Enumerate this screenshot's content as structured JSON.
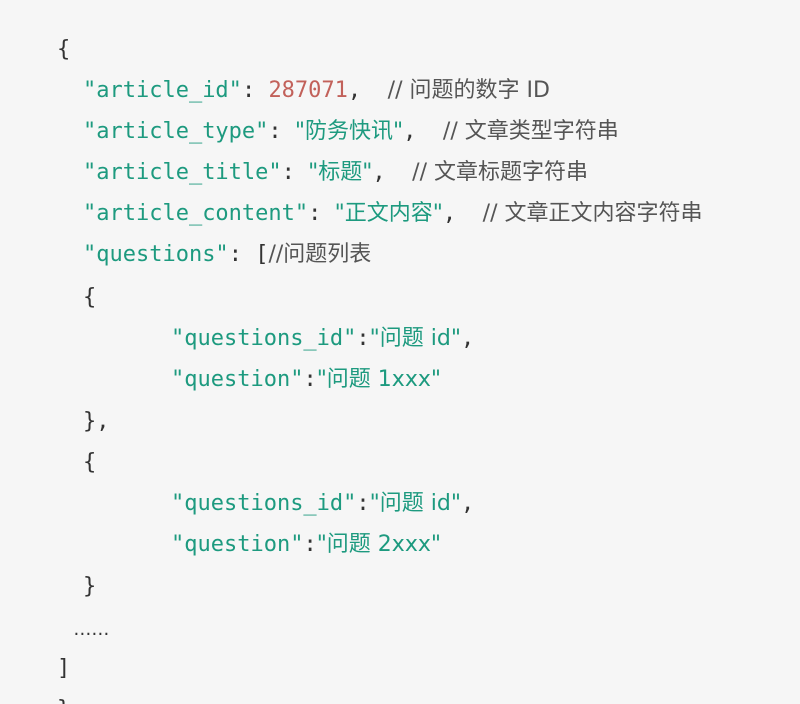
{
  "colors": {
    "background": "#f6f6f6",
    "key_string": "#1d9a7f",
    "number": "#c2615a",
    "comment": "#555555",
    "punctuation": "#333333"
  },
  "lines": {
    "open_brace": "{",
    "article_id": {
      "key": "\"article_id\"",
      "sep": ": ",
      "value": "287071",
      "tail": ",  ",
      "comment": "// 问题的数字 ID"
    },
    "article_type": {
      "key": "\"article_type\"",
      "sep": ": ",
      "value": "\"防务快讯\"",
      "tail": ",  ",
      "comment": "// 文章类型字符串"
    },
    "article_title": {
      "key": "\"article_title\"",
      "sep": ": ",
      "value": "\"标题\"",
      "tail": ",  ",
      "comment": "// 文章标题字符串"
    },
    "article_content": {
      "key": "\"article_content\"",
      "sep": ": ",
      "value": "\"正文内容\"",
      "tail": ",  ",
      "comment": "// 文章正文内容字符串"
    },
    "questions": {
      "key": "\"questions\"",
      "sep": ": ",
      "bracket": "[",
      "comment": "//问题列表"
    },
    "item1_open": "{",
    "item1_qid": {
      "key": "\"questions_id\"",
      "sep": ":",
      "value": "\"问题 id\"",
      "tail": ","
    },
    "item1_q": {
      "key": "\"question\"",
      "sep": ":",
      "value": "\"问题 1xxx\""
    },
    "item1_close": "},",
    "item2_open": "{",
    "item2_qid": {
      "key": "\"questions_id\"",
      "sep": ":",
      "value": "\"问题 id\"",
      "tail": ","
    },
    "item2_q": {
      "key": "\"question\"",
      "sep": ":",
      "value": "\"问题 2xxx\""
    },
    "item2_close": "}",
    "ellipsis": "……",
    "close_bracket": "]",
    "close_brace": "}"
  }
}
